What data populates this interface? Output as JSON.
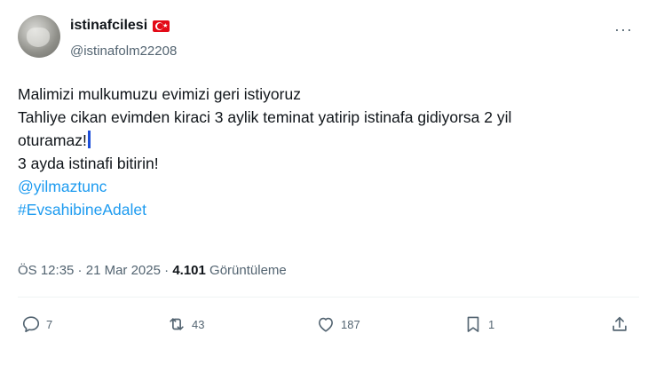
{
  "author": {
    "display_name": "istinafcilesi",
    "handle": "@istinafolm22208",
    "flag_icon": "turkey-flag-icon",
    "flag_colors": {
      "red": "#e30a17",
      "white": "#ffffff"
    }
  },
  "tweet": {
    "lines": [
      "Malimizi mulkumuzu evimizi geri istiyoruz",
      "Tahliye cikan evimden kiraci 3 aylik teminat yatirip  istinafa gidiyorsa 2 yil",
      "oturamaz!",
      "3 ayda istinafi bitirin!"
    ],
    "mention": "@yilmaztunc",
    "hashtag": "#EvsahibineAdalet"
  },
  "meta": {
    "time": "ÖS 12:35",
    "separator": " · ",
    "date": "21 Mar 2025",
    "views_count": "4.101",
    "views_label": "Görüntüleme"
  },
  "actions": {
    "replies": "7",
    "reposts": "43",
    "likes": "187",
    "bookmarks": "1"
  },
  "colors": {
    "link": "#1d9bf0",
    "secondary_text": "#536471",
    "primary_text": "#0f1419"
  }
}
